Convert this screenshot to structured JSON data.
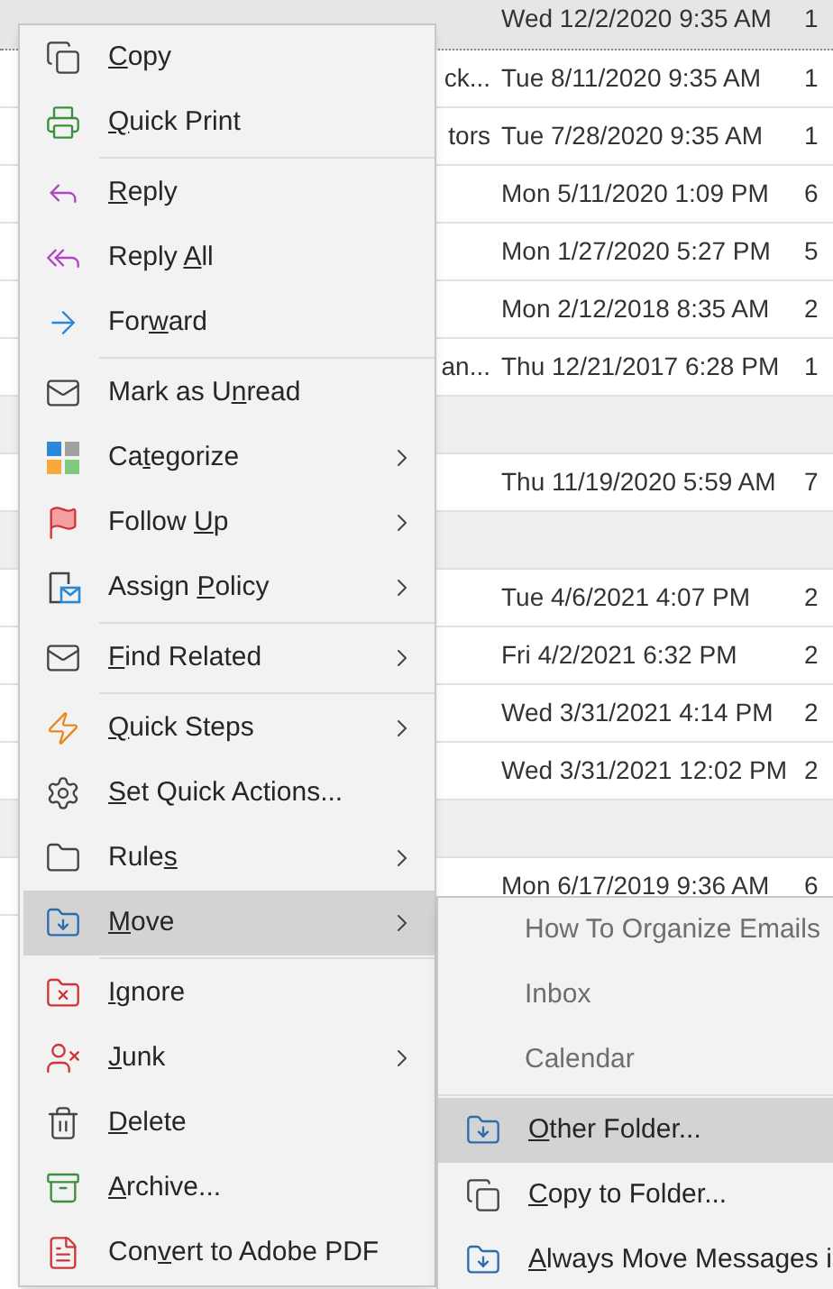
{
  "message_list": {
    "rows": [
      {
        "kind": "email",
        "date": "Wed 12/2/2020 9:35 AM",
        "count": "1",
        "selected": true
      },
      {
        "kind": "email",
        "subject": "ck...",
        "date": "Tue 8/11/2020 9:35 AM",
        "count": "1",
        "selected": false
      },
      {
        "kind": "email",
        "subject": "tors",
        "date": "Tue 7/28/2020 9:35 AM",
        "count": "1",
        "selected": false
      },
      {
        "kind": "email",
        "date": "Mon 5/11/2020 1:09 PM",
        "count": "6",
        "selected": false
      },
      {
        "kind": "email",
        "date": "Mon 1/27/2020 5:27 PM",
        "count": "5",
        "selected": false
      },
      {
        "kind": "email",
        "date": "Mon 2/12/2018 8:35 AM",
        "count": "2",
        "selected": false
      },
      {
        "kind": "email",
        "subject": "an...",
        "date": "Thu 12/21/2017 6:28 PM",
        "count": "1",
        "selected": false
      },
      {
        "kind": "group"
      },
      {
        "kind": "email",
        "date": "Thu 11/19/2020 5:59 AM",
        "count": "7",
        "selected": false
      },
      {
        "kind": "group"
      },
      {
        "kind": "email",
        "date": "Tue 4/6/2021 4:07 PM",
        "count": "2",
        "selected": false
      },
      {
        "kind": "email",
        "date": "Fri 4/2/2021 6:32 PM",
        "count": "2",
        "selected": false
      },
      {
        "kind": "email",
        "date": "Wed 3/31/2021 4:14 PM",
        "count": "2",
        "selected": false
      },
      {
        "kind": "email",
        "date": "Wed 3/31/2021 12:02 PM",
        "count": "2",
        "selected": false
      },
      {
        "kind": "group"
      },
      {
        "kind": "email",
        "date": "Mon 6/17/2019 9:36 AM",
        "count": "6",
        "selected": false
      }
    ]
  },
  "context_menu": {
    "items": [
      {
        "kind": "command",
        "accelerator": "C",
        "label_after": "opy",
        "submenu": false,
        "selected": false
      },
      {
        "kind": "command",
        "accelerator": "Q",
        "label_after": "uick Print",
        "submenu": false,
        "selected": false
      },
      {
        "kind": "separator"
      },
      {
        "kind": "command",
        "accelerator": "R",
        "label_after": "eply",
        "submenu": false,
        "selected": false
      },
      {
        "kind": "command",
        "label_before": "Reply ",
        "accelerator": "A",
        "label_after": "ll",
        "submenu": false,
        "selected": false
      },
      {
        "kind": "command",
        "label_before": "For",
        "accelerator": "w",
        "label_after": "ard",
        "submenu": false,
        "selected": false
      },
      {
        "kind": "separator"
      },
      {
        "kind": "command",
        "label_before": "Mark as U",
        "accelerator": "n",
        "label_after": "read",
        "submenu": false,
        "selected": false
      },
      {
        "kind": "command",
        "label_before": "Ca",
        "accelerator": "t",
        "label_after": "egorize",
        "submenu": true,
        "selected": false
      },
      {
        "kind": "command",
        "label_before": "Follow ",
        "accelerator": "U",
        "label_after": "p",
        "submenu": true,
        "selected": false
      },
      {
        "kind": "command",
        "label_before": "Assign ",
        "accelerator": "P",
        "label_after": "olicy",
        "submenu": true,
        "selected": false
      },
      {
        "kind": "separator"
      },
      {
        "kind": "command",
        "accelerator": "F",
        "label_after": "ind Related",
        "submenu": true,
        "selected": false
      },
      {
        "kind": "separator"
      },
      {
        "kind": "command",
        "accelerator": "Q",
        "label_after": "uick Steps",
        "submenu": true,
        "selected": false
      },
      {
        "kind": "command",
        "accelerator": "S",
        "label_after": "et Quick Actions...",
        "submenu": false,
        "selected": false
      },
      {
        "kind": "command",
        "label_before": "Rule",
        "accelerator": "s",
        "submenu": true,
        "selected": false
      },
      {
        "kind": "command",
        "accelerator": "M",
        "label_after": "ove",
        "submenu": true,
        "selected": true
      },
      {
        "kind": "separator"
      },
      {
        "kind": "command",
        "accelerator": "I",
        "label_after": "gnore",
        "submenu": false,
        "selected": false
      },
      {
        "kind": "command",
        "accelerator": "J",
        "label_after": "unk",
        "submenu": true,
        "selected": false
      },
      {
        "kind": "command",
        "accelerator": "D",
        "label_after": "elete",
        "submenu": false,
        "selected": false
      },
      {
        "kind": "command",
        "accelerator": "A",
        "label_after": "rchive...",
        "submenu": false,
        "selected": false
      },
      {
        "kind": "command",
        "label_before": "Con",
        "accelerator": "v",
        "label_after": "ert to Adobe PDF",
        "submenu": false,
        "selected": false
      }
    ]
  },
  "move_submenu": {
    "items": [
      {
        "kind": "folder",
        "label": "How To Organize Emails",
        "selected": false
      },
      {
        "kind": "folder",
        "label": "Inbox",
        "selected": false
      },
      {
        "kind": "folder",
        "label": "Calendar",
        "selected": false
      },
      {
        "kind": "separator"
      },
      {
        "kind": "command",
        "accelerator": "O",
        "label_after": "ther Folder...",
        "selected": true
      },
      {
        "kind": "command",
        "accelerator": "C",
        "label_after": "opy to Folder...",
        "selected": false
      },
      {
        "kind": "command",
        "accelerator": "A",
        "label_after": "lways Move Messages i",
        "selected": false
      }
    ]
  }
}
